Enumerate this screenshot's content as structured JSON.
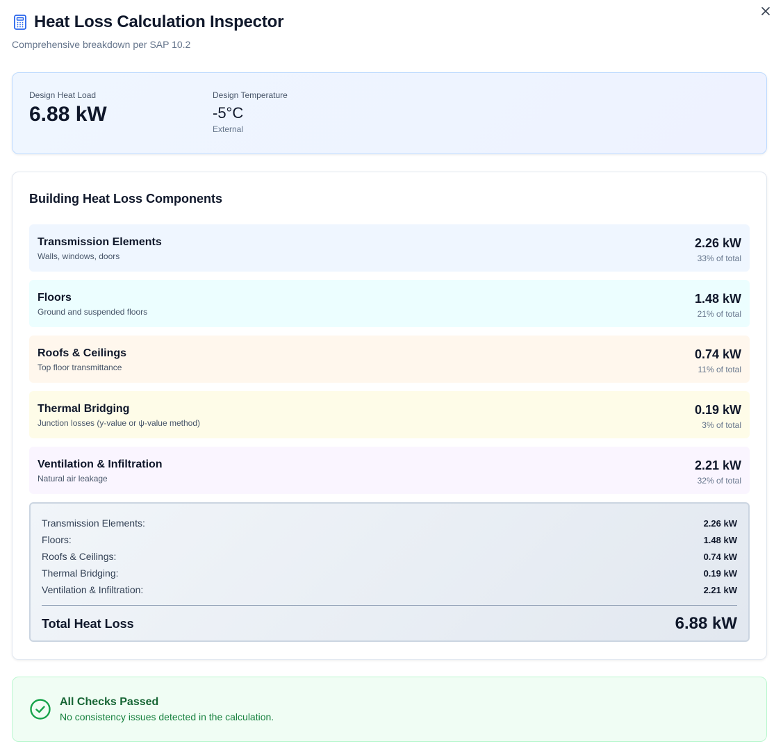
{
  "header": {
    "title": "Heat Loss Calculation Inspector",
    "subtitle": "Comprehensive breakdown per SAP 10.2",
    "icon": "calculator-icon"
  },
  "summary": {
    "heat_load_label": "Design Heat Load",
    "heat_load_value": "6.88 kW",
    "temperature_label": "Design Temperature",
    "temperature_value": "-5°C",
    "temperature_sub": "External"
  },
  "components": {
    "title": "Building Heat Loss Components",
    "items": [
      {
        "name": "Transmission Elements",
        "desc": "Walls, windows, doors",
        "value": "2.26 kW",
        "pct": "33% of total",
        "bg": "#eff6ff"
      },
      {
        "name": "Floors",
        "desc": "Ground and suspended floors",
        "value": "1.48 kW",
        "pct": "21% of total",
        "bg": "#ecfeff"
      },
      {
        "name": "Roofs & Ceilings",
        "desc": "Top floor transmittance",
        "value": "0.74 kW",
        "pct": "11% of total",
        "bg": "#fff7ed"
      },
      {
        "name": "Thermal Bridging",
        "desc": "Junction losses (y-value or ψ-value method)",
        "value": "0.19 kW",
        "pct": "3% of total",
        "bg": "#fefce8"
      },
      {
        "name": "Ventilation & Infiltration",
        "desc": "Natural air leakage",
        "value": "2.21 kW",
        "pct": "32% of total",
        "bg": "#faf5ff"
      }
    ],
    "totals": [
      {
        "label": "Transmission Elements:",
        "value": "2.26 kW"
      },
      {
        "label": "Floors:",
        "value": "1.48 kW"
      },
      {
        "label": "Roofs & Ceilings:",
        "value": "0.74 kW"
      },
      {
        "label": "Thermal Bridging:",
        "value": "0.19 kW"
      },
      {
        "label": "Ventilation & Infiltration:",
        "value": "2.21 kW"
      }
    ],
    "grand_label": "Total Heat Loss",
    "grand_value": "6.88 kW"
  },
  "status": {
    "title": "All Checks Passed",
    "desc": "No consistency issues detected in the calculation.",
    "icon": "check-circle-icon"
  },
  "close_label": "×"
}
